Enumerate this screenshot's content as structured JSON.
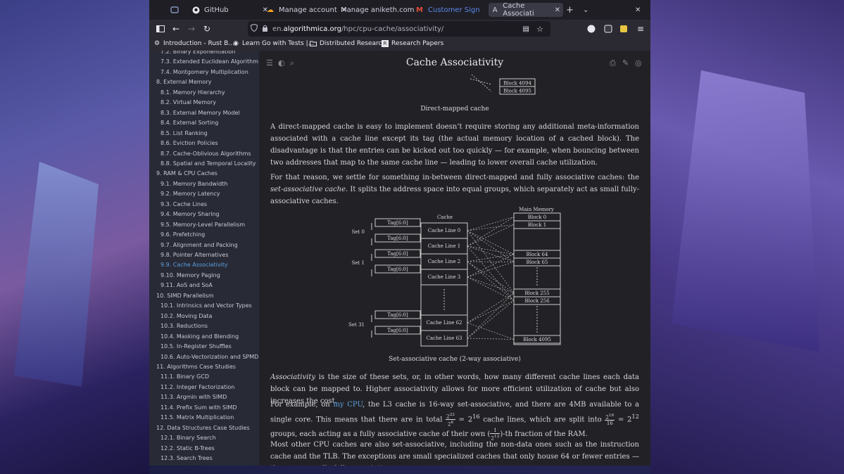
{
  "tabs": [
    {
      "label": "",
      "icon": "container-icon"
    },
    {
      "label": "GitHub",
      "icon": "github-icon"
    },
    {
      "label": "Manage account",
      "icon": "cloud-icon"
    },
    {
      "label": "Manage aniketh.com",
      "icon": ""
    },
    {
      "label": "Customer Sign",
      "icon": "gmail-icon"
    },
    {
      "label": "Cache Associati",
      "icon": "wiki-icon"
    }
  ],
  "url": {
    "prefix": "en.",
    "host": "algorithmica.org",
    "path": "/hpc/cpu-cache/associativity/"
  },
  "bookmarks": [
    "Introduction - Rust B...",
    "Learn Go with Tests |...",
    "Distributed Research",
    "Research Papers"
  ],
  "sidebar": [
    {
      "label": "7.2. Binary Exponentiation",
      "type": "sub"
    },
    {
      "label": "7.3. Extended Euclidean Algorithm",
      "type": "sub"
    },
    {
      "label": "7.4. Montgomery Multiplication",
      "type": "sub"
    },
    {
      "label": "8. External Memory",
      "type": "section"
    },
    {
      "label": "8.1. Memory Hierarchy",
      "type": "sub"
    },
    {
      "label": "8.2. Virtual Memory",
      "type": "sub"
    },
    {
      "label": "8.3. External Memory Model",
      "type": "sub"
    },
    {
      "label": "8.4. External Sorting",
      "type": "sub"
    },
    {
      "label": "8.5. List Ranking",
      "type": "sub"
    },
    {
      "label": "8.6. Eviction Policies",
      "type": "sub"
    },
    {
      "label": "8.7. Cache-Oblivious Algorithms",
      "type": "sub"
    },
    {
      "label": "8.8. Spatial and Temporal Locality",
      "type": "sub"
    },
    {
      "label": "9. RAM & CPU Caches",
      "type": "section"
    },
    {
      "label": "9.1. Memory Bandwidth",
      "type": "sub"
    },
    {
      "label": "9.2. Memory Latency",
      "type": "sub"
    },
    {
      "label": "9.3. Cache Lines",
      "type": "sub"
    },
    {
      "label": "9.4. Memory Sharing",
      "type": "sub"
    },
    {
      "label": "9.5. Memory-Level Parallelism",
      "type": "sub"
    },
    {
      "label": "9.6. Prefetching",
      "type": "sub"
    },
    {
      "label": "9.7. Alignment and Packing",
      "type": "sub"
    },
    {
      "label": "9.8. Pointer Alternatives",
      "type": "sub"
    },
    {
      "label": "9.9. Cache Associativity",
      "type": "active"
    },
    {
      "label": "9.10. Memory Paging",
      "type": "sub"
    },
    {
      "label": "9.11. AoS and SoA",
      "type": "sub"
    },
    {
      "label": "10. SIMD Parallelism",
      "type": "section"
    },
    {
      "label": "10.1. Intrinsics and Vector Types",
      "type": "sub"
    },
    {
      "label": "10.2. Moving Data",
      "type": "sub"
    },
    {
      "label": "10.3. Reductions",
      "type": "sub"
    },
    {
      "label": "10.4. Masking and Blending",
      "type": "sub"
    },
    {
      "label": "10.5. In-Register Shuffles",
      "type": "sub"
    },
    {
      "label": "10.6. Auto-Vectorization and SPMD",
      "type": "sub"
    },
    {
      "label": "11. Algorithms Case Studies",
      "type": "section"
    },
    {
      "label": "11.1. Binary GCD",
      "type": "sub"
    },
    {
      "label": "11.2. Integer Factorization",
      "type": "sub"
    },
    {
      "label": "11.3. Argmin with SIMD",
      "type": "sub"
    },
    {
      "label": "11.4. Prefix Sum with SIMD",
      "type": "sub"
    },
    {
      "label": "11.5. Matrix Multiplication",
      "type": "sub"
    },
    {
      "label": "12. Data Structures Case Studies",
      "type": "section"
    },
    {
      "label": "12.1. Binary Search",
      "type": "sub"
    },
    {
      "label": "12.2. Static B-Trees",
      "type": "sub"
    },
    {
      "label": "12.3. Search Trees",
      "type": "sub"
    }
  ],
  "page": {
    "title": "Cache Associativity",
    "top_blocks": [
      "Block 4094",
      "Block 4095"
    ],
    "caption1": "Direct-mapped cache",
    "para1": "A direct-mapped cache is easy to implement doesn’t require storing any additional meta-information associated with a cache line except its tag (the actual memory location of a cached block). The disadvantage is that the entries can be kicked out too quickly — for example, when bouncing between two addresses that map to the same cache line — leading to lower overall cache utilization.",
    "para2_a": "For that reason, we settle for something in-between direct-mapped and fully associative caches: the ",
    "para2_em": "set-associative cache",
    "para2_b": ". It splits the address space into equal groups, which separately act as small fully-associative caches.",
    "diagram": {
      "cache_label": "Cache",
      "memory_label": "Main Memory",
      "tag_label": "Tag[6:0]",
      "sets": [
        "Set 0",
        "Set 1",
        "Set 31"
      ],
      "cache_lines": [
        "Cache Line 0",
        "Cache Line 1",
        "Cache Line 2",
        "Cache Line 3",
        "Cache Line 62",
        "Cache Line 63"
      ],
      "blocks": [
        "Block 0",
        "Block 1",
        "Block 64",
        "Block 65",
        "Block 255",
        "Block 256",
        "Block 4095"
      ]
    },
    "caption2": "Set-associative cache (2-way associative)",
    "para3_em": "Associativity",
    "para3": " is the size of these sets, or, in other words, how many different cache lines each data block can be mapped to. Higher associativity allows for more efficient utilization of cache but also increases the cost.",
    "para4_a": "For example, on ",
    "para4_link": "my CPU",
    "para4_b": ", the L3 cache is 16-way set-associative, and there are 4MB available to a single core. This means that there are in total ",
    "para4_c": " cache lines, which are split into ",
    "para4_d": " groups, each acting as a fully associative cache of their own (",
    "para4_e": ")-th fraction of the RAM.",
    "para5": "Most other CPU caches are also set-associative, including the non-data ones such as the instruction cache and the TLB. The exceptions are small specialized caches that only house 64 or fewer entries — these are usually fully associative."
  }
}
